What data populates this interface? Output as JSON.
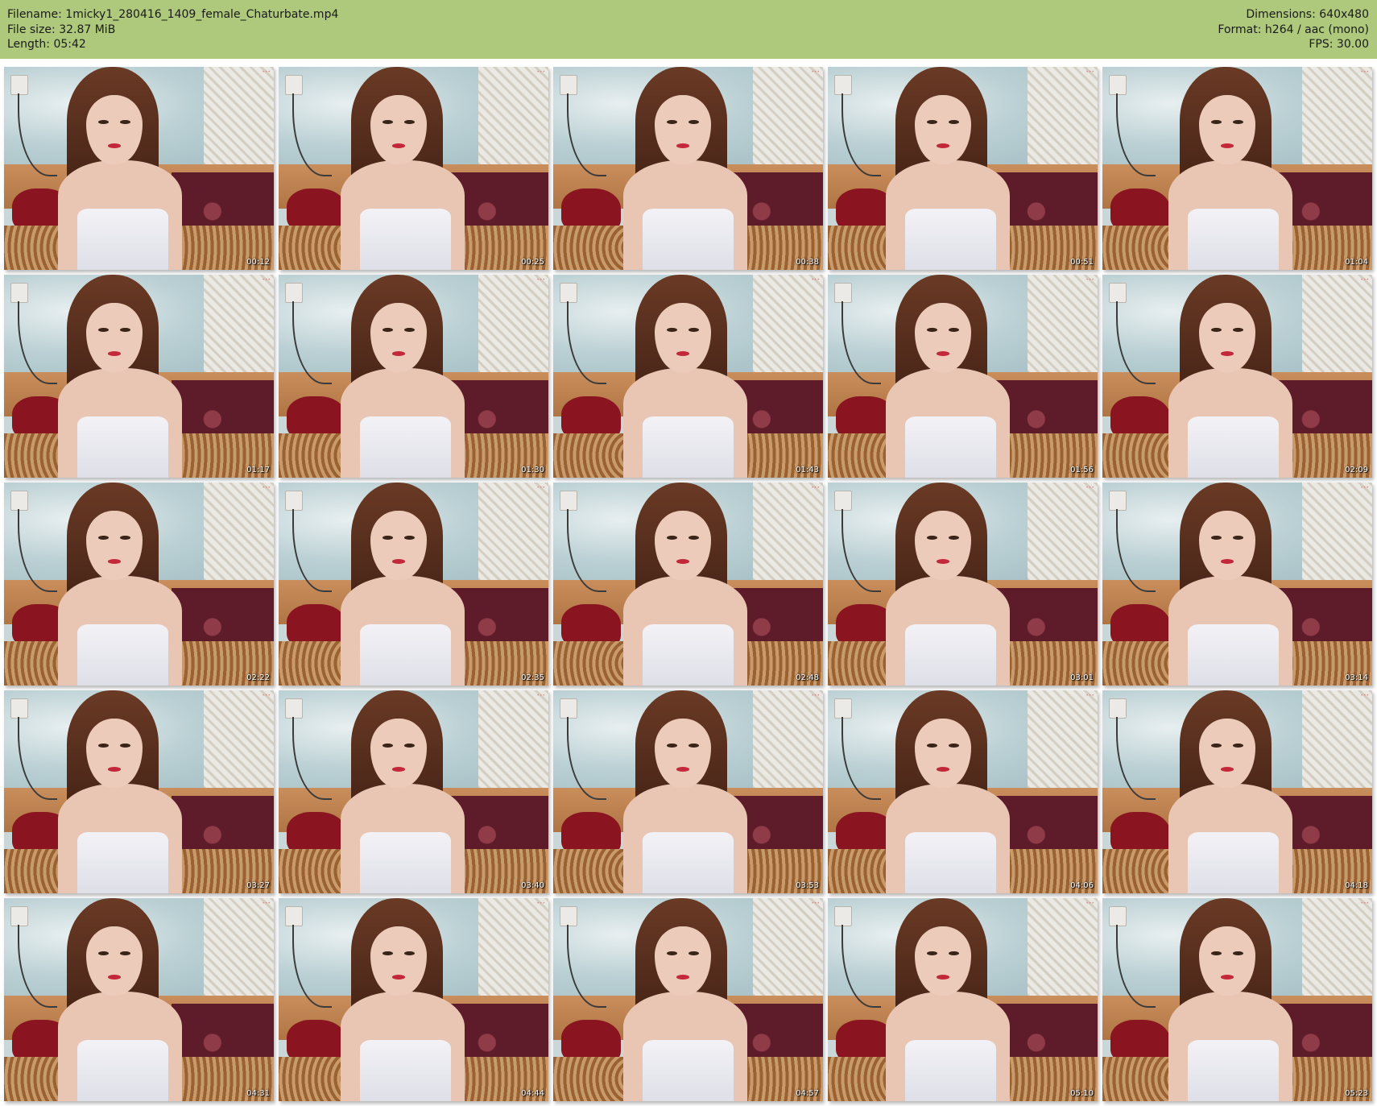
{
  "header": {
    "filename_line": "Filename: 1micky1_280416_1409_female_Chaturbate.mp4",
    "filesize_line": "File size: 32.87 MiB",
    "length_line": "Length: 05:42",
    "dimensions_line": "Dimensions: 640x480",
    "format_line": "Format: h264 / aac (mono)",
    "fps_line": "FPS: 30.00",
    "background_color": "#aec97c"
  },
  "thumbnails": [
    {
      "timestamp": "00:12"
    },
    {
      "timestamp": "00:25"
    },
    {
      "timestamp": "00:38"
    },
    {
      "timestamp": "00:51"
    },
    {
      "timestamp": "01:04"
    },
    {
      "timestamp": "01:17"
    },
    {
      "timestamp": "01:30"
    },
    {
      "timestamp": "01:43"
    },
    {
      "timestamp": "01:56"
    },
    {
      "timestamp": "02:09"
    },
    {
      "timestamp": "02:22"
    },
    {
      "timestamp": "02:35"
    },
    {
      "timestamp": "02:48"
    },
    {
      "timestamp": "03:01"
    },
    {
      "timestamp": "03:14"
    },
    {
      "timestamp": "03:27"
    },
    {
      "timestamp": "03:40"
    },
    {
      "timestamp": "03:53"
    },
    {
      "timestamp": "04:06"
    },
    {
      "timestamp": "04:18"
    },
    {
      "timestamp": "04:31"
    },
    {
      "timestamp": "04:44"
    },
    {
      "timestamp": "04:57"
    },
    {
      "timestamp": "05:10"
    },
    {
      "timestamp": "05:23"
    }
  ]
}
